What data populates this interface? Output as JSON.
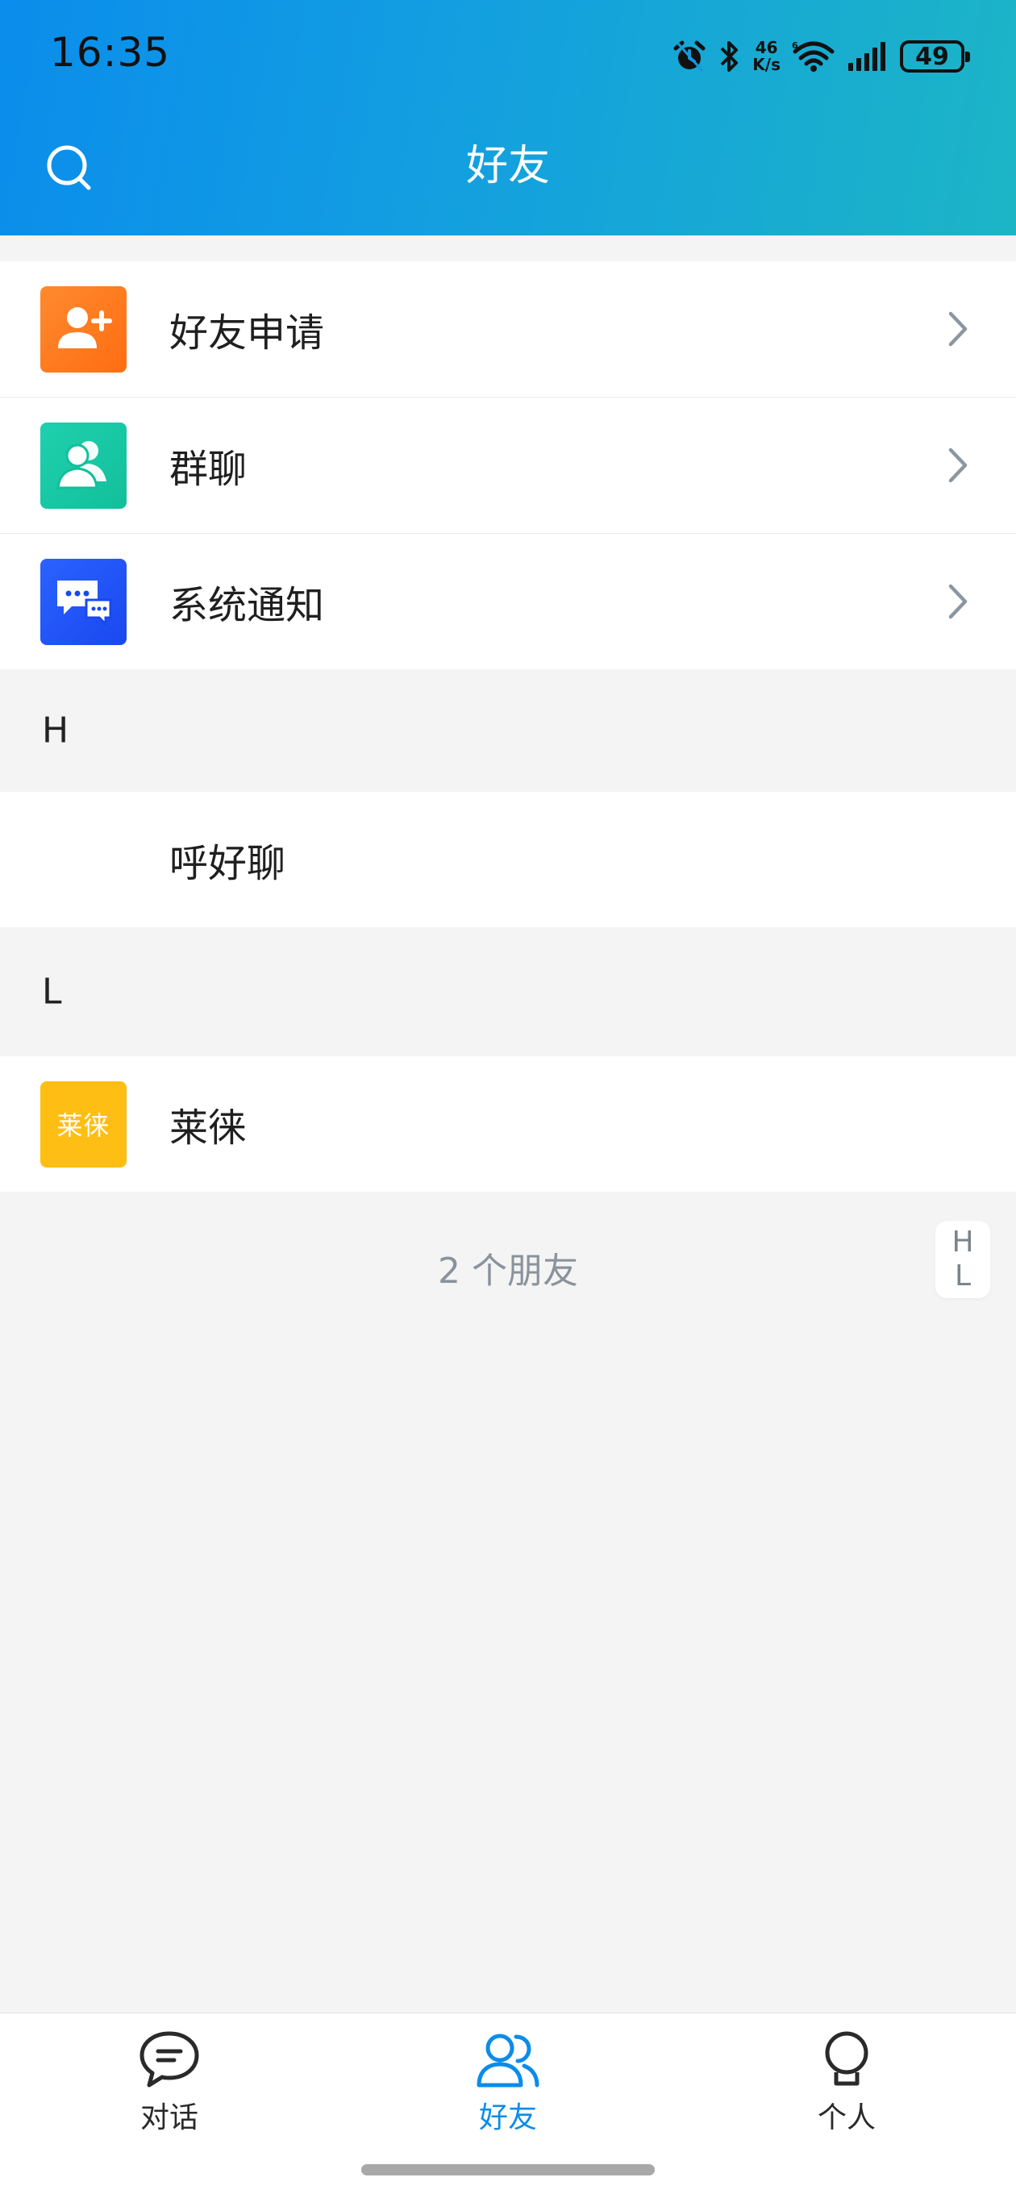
{
  "status_bar": {
    "time": "16:35",
    "network_speed_top": "46",
    "network_speed_bottom": "K/s",
    "battery": "49"
  },
  "header": {
    "title": "好友"
  },
  "shortcuts": [
    {
      "label": "好友申请",
      "icon": "add-user-icon",
      "color": "#ff7a22"
    },
    {
      "label": "群聊",
      "icon": "group-icon",
      "color": "#19c9a5"
    },
    {
      "label": "系统通知",
      "icon": "notification-chat-icon",
      "color": "#2356f6"
    }
  ],
  "sections": [
    {
      "letter": "H",
      "friends": [
        {
          "name": "呼好聊",
          "avatar_text": ""
        }
      ]
    },
    {
      "letter": "L",
      "friends": [
        {
          "name": "莱徕",
          "avatar_text": "莱徕",
          "avatar_color": "#ffbe14"
        }
      ]
    }
  ],
  "friend_count": "2 个朋友",
  "index_letters": [
    "H",
    "L"
  ],
  "bottom_nav": [
    {
      "label": "对话",
      "icon": "chat-icon",
      "active": false
    },
    {
      "label": "好友",
      "icon": "friends-icon",
      "active": true
    },
    {
      "label": "个人",
      "icon": "profile-icon",
      "active": false
    }
  ],
  "colors": {
    "accent": "#0b8ce9",
    "header_gradient_start": "#0a8dec",
    "header_gradient_end": "#1cb5c6"
  }
}
